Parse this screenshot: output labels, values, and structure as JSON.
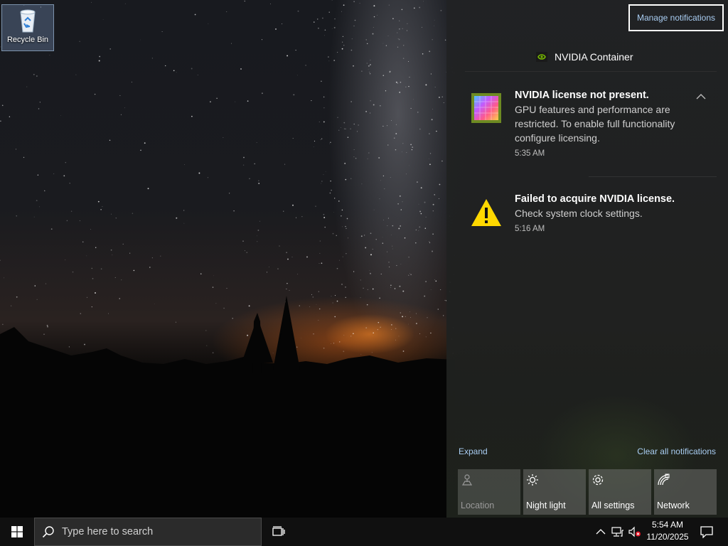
{
  "desktop": {
    "icons": [
      {
        "label": "Recycle Bin",
        "icon": "recycle-bin-icon"
      }
    ]
  },
  "action_center": {
    "manage_label": "Manage notifications",
    "group": {
      "app_name": "NVIDIA Container",
      "icon": "nvidia-logo-icon",
      "notifications": [
        {
          "title": "NVIDIA license not present.",
          "body": "GPU features and performance are restricted. To enable full functionality configure licensing.",
          "time": "5:35 AM",
          "icon": "gpu-chip-icon"
        },
        {
          "title": "Failed to acquire NVIDIA license.",
          "body": "Check system clock settings.",
          "time": "5:16 AM",
          "icon": "warning-icon"
        }
      ]
    },
    "expand_label": "Expand",
    "clear_label": "Clear all notifications",
    "quick_actions": [
      {
        "label": "Location",
        "icon": "location-icon",
        "enabled": false
      },
      {
        "label": "Night light",
        "icon": "brightness-icon",
        "enabled": true
      },
      {
        "label": "All settings",
        "icon": "gear-icon",
        "enabled": true
      },
      {
        "label": "Network",
        "icon": "network-icon",
        "enabled": true
      }
    ]
  },
  "taskbar": {
    "search_placeholder": "Type here to search",
    "clock": {
      "time": "5:54 AM",
      "date": "11/20/2025"
    },
    "tray_icons": [
      "chevron-up-icon",
      "network-wired-icon",
      "volume-muted-icon"
    ]
  },
  "colors": {
    "link": "#a9cdf2",
    "warning": "#ffd800",
    "nvidia_green": "#76b900"
  }
}
